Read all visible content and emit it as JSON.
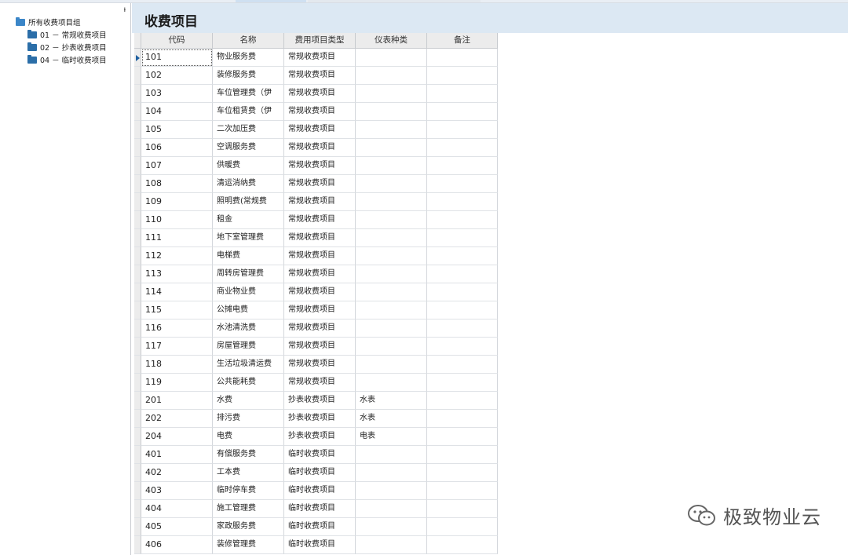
{
  "sidebar": {
    "pin_glyph": "ᵼ",
    "root_label": "所有收费项目组",
    "groups": [
      {
        "label": "01 － 常规收费项目"
      },
      {
        "label": "02 － 抄表收费项目"
      },
      {
        "label": "04 － 临时收费项目"
      }
    ]
  },
  "main": {
    "title": "收费项目"
  },
  "table": {
    "columns": [
      "代码",
      "名称",
      "费用项目类型",
      "仪表种类",
      "备注"
    ],
    "rows": [
      {
        "code": "101",
        "name": "物业服务费",
        "type": "常规收费项目",
        "meter": "",
        "note": ""
      },
      {
        "code": "102",
        "name": "装修服务费",
        "type": "常规收费项目",
        "meter": "",
        "note": ""
      },
      {
        "code": "103",
        "name": "车位管理费（伊",
        "type": "常规收费项目",
        "meter": "",
        "note": ""
      },
      {
        "code": "104",
        "name": "车位租赁费（伊",
        "type": "常规收费项目",
        "meter": "",
        "note": ""
      },
      {
        "code": "105",
        "name": "二次加压费",
        "type": "常规收费项目",
        "meter": "",
        "note": ""
      },
      {
        "code": "106",
        "name": "空调服务费",
        "type": "常规收费项目",
        "meter": "",
        "note": ""
      },
      {
        "code": "107",
        "name": "供暖费",
        "type": "常规收费项目",
        "meter": "",
        "note": ""
      },
      {
        "code": "108",
        "name": "清运消纳费",
        "type": "常规收费项目",
        "meter": "",
        "note": ""
      },
      {
        "code": "109",
        "name": "照明费(常规费",
        "type": "常规收费项目",
        "meter": "",
        "note": ""
      },
      {
        "code": "110",
        "name": "租金",
        "type": "常规收费项目",
        "meter": "",
        "note": ""
      },
      {
        "code": "111",
        "name": "地下室管理费",
        "type": "常规收费项目",
        "meter": "",
        "note": ""
      },
      {
        "code": "112",
        "name": "电梯费",
        "type": "常规收费项目",
        "meter": "",
        "note": ""
      },
      {
        "code": "113",
        "name": "周转房管理费",
        "type": "常规收费项目",
        "meter": "",
        "note": ""
      },
      {
        "code": "114",
        "name": "商业物业费",
        "type": "常规收费项目",
        "meter": "",
        "note": ""
      },
      {
        "code": "115",
        "name": "公摊电费",
        "type": "常规收费项目",
        "meter": "",
        "note": ""
      },
      {
        "code": "116",
        "name": "水池清洗费",
        "type": "常规收费项目",
        "meter": "",
        "note": ""
      },
      {
        "code": "117",
        "name": "房屋管理费",
        "type": "常规收费项目",
        "meter": "",
        "note": ""
      },
      {
        "code": "118",
        "name": "生活垃圾清运费",
        "type": "常规收费项目",
        "meter": "",
        "note": ""
      },
      {
        "code": "119",
        "name": "公共能耗费",
        "type": "常规收费项目",
        "meter": "",
        "note": ""
      },
      {
        "code": "201",
        "name": "水费",
        "type": "抄表收费项目",
        "meter": "水表",
        "note": ""
      },
      {
        "code": "202",
        "name": "排污费",
        "type": "抄表收费项目",
        "meter": "水表",
        "note": ""
      },
      {
        "code": "204",
        "name": "电费",
        "type": "抄表收费项目",
        "meter": "电表",
        "note": ""
      },
      {
        "code": "401",
        "name": "有偿服务费",
        "type": "临时收费项目",
        "meter": "",
        "note": ""
      },
      {
        "code": "402",
        "name": "工本费",
        "type": "临时收费项目",
        "meter": "",
        "note": ""
      },
      {
        "code": "403",
        "name": "临时停车费",
        "type": "临时收费项目",
        "meter": "",
        "note": ""
      },
      {
        "code": "404",
        "name": "施工管理费",
        "type": "临时收费项目",
        "meter": "",
        "note": ""
      },
      {
        "code": "405",
        "name": "家政服务费",
        "type": "临时收费项目",
        "meter": "",
        "note": ""
      },
      {
        "code": "406",
        "name": "装修管理费",
        "type": "临时收费项目",
        "meter": "",
        "note": ""
      }
    ]
  },
  "watermark": {
    "text": "极致物业云",
    "icon": "wechat-icon"
  }
}
